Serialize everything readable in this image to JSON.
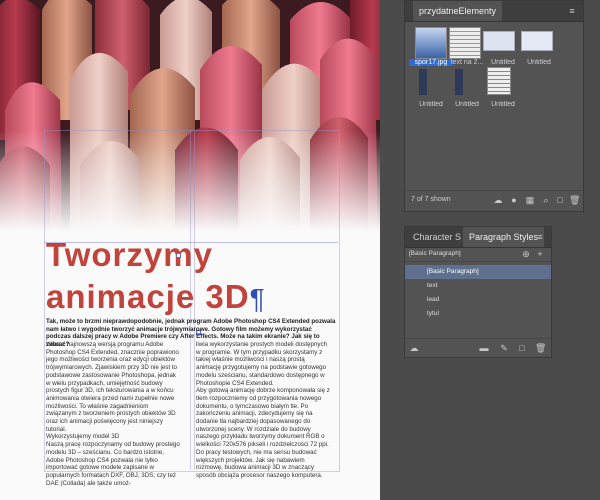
{
  "panel_elements": {
    "title": "przydatneElementy",
    "items": [
      {
        "label": "spor17.jpg",
        "selected": true
      },
      {
        "label": "text na 2...",
        "selected": false
      },
      {
        "label": "Untitled",
        "selected": false
      },
      {
        "label": "Untitled",
        "selected": false
      },
      {
        "label": "Untitled",
        "selected": false
      },
      {
        "label": "Untitled",
        "selected": false
      },
      {
        "label": "Untitled",
        "selected": false
      }
    ],
    "count_text": "7 of 7 shown"
  },
  "panel_styles": {
    "tabs": [
      "Character S",
      "Paragraph Styles"
    ],
    "current": "[Basic Paragraph]",
    "items": [
      "[Basic Paragraph]",
      "text",
      "lead",
      "tytul"
    ],
    "selected_index": 0
  },
  "document": {
    "headline_line1": "Tworzymy",
    "headline_line2": "animacje 3D",
    "pilcrow": "¶",
    "lead": "Tak, może to brzmi nieprawdopodobnie, jednak program Adobe Photoshop CS4 Extended pozwala nam łatwo i wygodnie tworzyć animacje trójwymiarowe. Gotowy film możemy wykorzystać podczas dalszej pracy w Adobe Premiere czy After Effects. Może na takim ekranie? Jak się to zabrać?",
    "left_col": [
      "Wraz z najnowszą wersją programu Adobe Photoshop CS4 Extended, znacznie poprawiono jego możliwości tworzenia oraz edycji obiektów trójwymiarowych. Zjawiskiem przy 3D nie jest to podstawowe zastosowanie Photoshopa, jednak w wielu przypadkach, umiejętność budowy prostych figur 3D, ich teksturowania a w końcu animowania otwiera przed nami zupełnie nowe możliwości. To właśnie zagadnieniom związanym z tworzeniem prostych obiektów 3D oraz ich animacji poświęcony jest niniejszy tutorial.",
      "Wykorzystujemy model 3D",
      "Naszą pracę rozpoczynamy od budowy prostego modelu 3D – sześcianu. Co bardzo istotne, Adobe Photoshop CS4 pozwala nie tylko importować gotowe modele zapisane w popularnych formatach DXF, OBJ, 3DS, czy też DAE (Collada) ale także umoż-"
    ],
    "right_col": [
      "liwia wykorzystanie prostych modeli dostępnych w programie. W tym przypadku skorzystamy z takiej właśnie możliwości i naszą prostą animację przygotujemy na podstawie gotowego modelu sześcianu, standardowo dostępnego w Photoshopie CS4 Extended.",
      "Aby gotową animację dobrze komponowała się z tłem rozpoczniemy od przygotowania nowego dokumentu, o tymczasowo białym tle. Po zakończeniu animacji, zdecydujemy się na dodanie tła najbardziej dopasowanego do utworzonej sceny. W rozdziale do budowy naszego przykładu tworzymy dokument RGB o wielkości 720x576 pikseli i rozdzielczości 72 ppi. Do pracy testowych, nie ma sensu budować większych projektów. Jak się nabawiem rozmowę, budowa animacji 3D w znaczący sposób obciąża procesor naszego komputera."
    ]
  },
  "icons": [
    "cloud-icon",
    "folder-icon",
    "new-item-icon",
    "trash-icon",
    "search-icon",
    "menu-icon"
  ],
  "colors": {
    "headline": "#c0443c",
    "pilcrow": "#2f4fb6",
    "selection": "#2d6bd6",
    "panel": "#535353"
  }
}
